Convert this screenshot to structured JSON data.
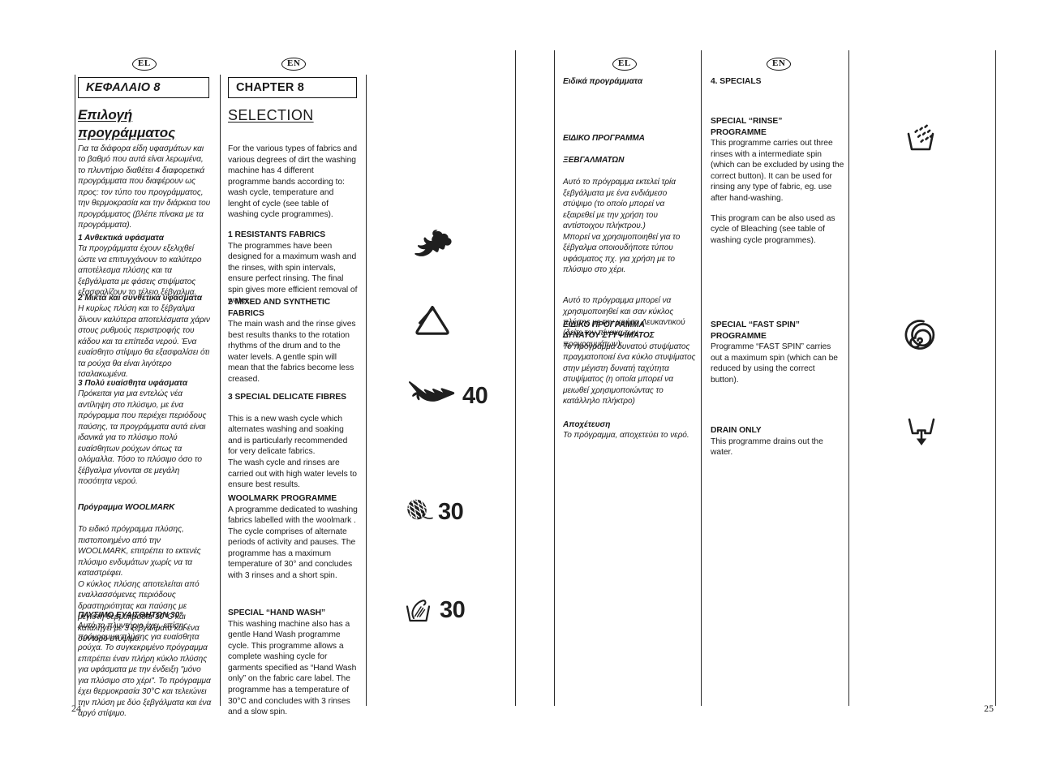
{
  "meta": {
    "left_page_number": "24",
    "right_page_number": "25",
    "badge_el": "EL",
    "badge_en": "EN"
  },
  "left_page": {
    "el_column": {
      "chapter_label": "ΚΕΦΑΛΑΙΟ 8",
      "title_line1": "Επιλογή",
      "title_line2": "προγράμματος",
      "intro": "Για τα διάφορα είδη υφασμάτων και το βαθμό που αυτά είναι λερωμένα, το πλυντήριο διαθέτει 4 διαφορετικά προγράμματα που διαφέρουν ως προς: τον τύπο του προγράμματος, την θερμοκρασία και την διάρκεια του προγράμματος (βλέπε πίνακα με τα προγράμματα).",
      "sections": [
        {
          "heading": "1 Ανθεκτικά υφάσματα",
          "body": "Τα προγράμματα έχουν εξελιχθεί ώστε να επιτυγχάνουν το καλύτερο αποτέλεσμα πλύσης και τα ξεβγάλματα με φάσεις στιψίματος εξασφαλίζουν το τέλειο ξέβγαλμα."
        },
        {
          "heading": "2 Μικτά και συνθετικά υφάσματα",
          "body": "Η κυρίως πλύση και το ξέβγαλμα δίνουν καλύτερα αποτελέσματα χάριν στους ρυθμούς περιστροφής του κάδου και τα επίπεδα νερού. Ένα ευαίσθητο στίψιμο θα εξασφαλίσει ότι τα ρούχα θα είναι λιγότερο τσαλακωμένα."
        },
        {
          "heading": "3 Πολύ ευαίσθητα υφάσματα",
          "body": "Πρόκειται για μια εντελώς νέα αντίληψη στο πλύσιμο, με ένα πρόγραμμα που περιέχει περιόδους παύσης, τα προγράμματα αυτά είναι ιδανικά για το πλύσιμο πολύ ευαίσθητων ρούχων όπως τα ολόμαλλα. Τόσο το πλύσιμο όσο το ξέβγαλμα γίνονται σε μεγάλη ποσότητα νερού."
        },
        {
          "heading": "Πρόγραμμα WOOLMARK",
          "body": "Το ειδικό πρόγραμμα πλύσης, πιστοποιημένο από την WOOLMARK, επιτρέπει το εκτενές πλύσιμο ενδυμάτων χωρίς να τα καταστρέφει.\nΟ κύκλος πλύσης αποτελείται από εναλλασσόμενες περιόδους δραστηριότητας και παύσης με μέγιστη θερμοκρασία 30°C και καταλήγει με 3 ξεβγάλματα και ένα σύντομο στύψιμο."
        },
        {
          "heading": "ΠΛΥΣΙΜΟ ΕΥΑΙΣΘΗΤΩΝ 30°",
          "body": "Αυτό το πλυντήριο έχει, επίσης, πρόγραμμα πλύσης για ευαίσθητα ρούχα. Το συγκεκριμένο πρόγραμμα επιτρέπει έναν πλήρη κύκλο πλύσης για υφάσματα με την ένδειξη \"μόνο για πλύσιμο στο χέρι\". Το πρόγραμμα έχει θερμοκρασία 30°C και τελειώνει την πλύση με δύο ξεβγάλματα και ένα αργό στίψιμο."
        }
      ]
    },
    "en_column": {
      "chapter_label": "CHAPTER 8",
      "title": "SELECTION",
      "intro": "For the various types of fabrics and various degrees of dirt the washing machine has 4 different programme bands according to: wash cycle, temperature and lenght of cycle (see table of washing cycle programmes).",
      "sections": [
        {
          "heading": "1 RESISTANTS FABRICS",
          "body": "The programmes have been designed for a maximum wash and the rinses, with spin intervals, ensure perfect rinsing. The final spin gives more efficient removal of water."
        },
        {
          "heading": "2 MIXED AND SYNTHETIC FABRICS",
          "body": "The main wash and the rinse gives best results thanks to the rotation rhythms of the drum and to the water levels. A gentle spin will mean that the fabrics become less creased."
        },
        {
          "heading": "3 SPECIAL DELICATE FIBRES",
          "body": "This is a new wash cycle which alternates washing and soaking and is particularly recommended for very delicate fabrics.\nThe wash cycle and rinses are carried out with high water levels to ensure best results."
        },
        {
          "heading": "WOOLMARK PROGRAMME",
          "body": "A programme dedicated to washing fabrics labelled with the woolmark . The cycle comprises of alternate periods of activity and pauses. The programme has a maximum temperature of 30° and concludes with 3 rinses and a short spin."
        },
        {
          "heading": "SPECIAL “HAND WASH”",
          "body": "This washing machine also has a gentle Hand Wash programme cycle. This programme allows a complete washing cycle for garments specified as “Hand Wash only” on the fabric care label. The programme has a temperature of 30°C and concludes with 3 rinses and a slow spin."
        }
      ]
    },
    "symbols": [
      {
        "icon": "cotton-boll-icon",
        "label": ""
      },
      {
        "icon": "synthetics-triangle-icon",
        "label": ""
      },
      {
        "icon": "feather-delicate-icon",
        "label": "40"
      },
      {
        "icon": "wool-yarn-icon",
        "label": "30"
      },
      {
        "icon": "hand-wash-basin-icon",
        "label": "30"
      }
    ]
  },
  "right_page": {
    "el_column": {
      "title": "Ειδικά προγράμματα",
      "sections": [
        {
          "heading_line1": "ΕΙΔΙΚΟ ΠΡΟΓΡΑΜΜΑ",
          "heading_line2": "ΞΕΒΓΑΛΜΑΤΩΝ",
          "body1": "Αυτό το πρόγραμμα εκτελεί τρία ξεβγάλματα με ένα ενδιάμεσο στύψιμο (το οποίο μπορεί να εξαιρεθεί με την χρήση του αντίστοιχου πλήκτρου.)\n Μπορεί να χρησιμοποιηθεί για το ξέβγαλμα οποιουδήποτε τύπου υφάσματος πχ. για χρήση με το πλύσιμο στο χέρι.",
          "body2": "Αυτό το πρόγραμμα μπορεί να χρησιμοποιηθεί και σαν κύκλος πλύσης με την χρήση Λευκαντικού (δείτε τον πίνακα των προγραμμάτων)."
        },
        {
          "heading_line1": "ΕΙΔΙΚΟ ΠΡΟΓΡΑΜΜΑ",
          "heading_line2": "ΔΥΝΑΤΟΥ ΣΤΥΨΙΜΑΤΟΣ",
          "body1": "Το πρόγραμμα δυνατού στυψίματος πραγματοποιεί ένα κύκλο στυψίματος στην μέγιστη δυνατή ταχύτητα στυψίματος (η οποία μπορεί να μειωθεί χρησιμοποιώντας το κατάλληλο πλήκτρο)",
          "body2": ""
        },
        {
          "heading_line1": "Αποχέτευση",
          "heading_line2": "",
          "body1": "Το πρόγραμμα, αποχετεύει το νερό.",
          "body2": ""
        }
      ]
    },
    "en_column": {
      "title": "4. SPECIALS",
      "sections": [
        {
          "heading_line1": "SPECIAL “RINSE”",
          "heading_line2": "PROGRAMME",
          "body1": "This programme carries out three rinses with a intermediate spin (which can be excluded by using the correct button). It can be used for rinsing any type of fabric, eg. use after hand-washing.",
          "body2": "This program can be also used  as cycle of Bleaching (see table of washing cycle programmes)."
        },
        {
          "heading_line1": "SPECIAL “FAST SPIN”",
          "heading_line2": "PROGRAMME",
          "body1": "Programme “FAST SPIN” carries out a maximum spin (which can be reduced by using the correct button).",
          "body2": ""
        },
        {
          "heading_line1": "DRAIN ONLY",
          "heading_line2": "",
          "body1": "This programme drains out the water.",
          "body2": ""
        }
      ]
    },
    "symbols": [
      {
        "icon": "rinse-basin-icon"
      },
      {
        "icon": "fast-spin-spiral-icon"
      },
      {
        "icon": "drain-basin-arrow-icon"
      }
    ]
  }
}
